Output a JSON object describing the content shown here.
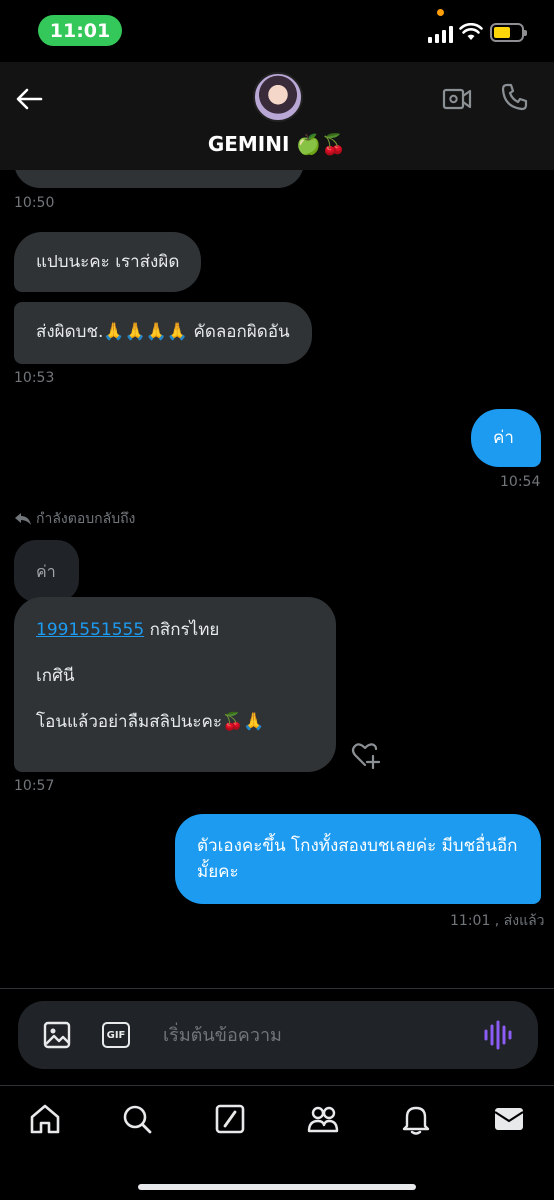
{
  "status_bar": {
    "time": "11:01"
  },
  "header": {
    "contact_name": "GEMINI 🍏🍒"
  },
  "conversation": {
    "time_1": "10:50",
    "msg_1": "แปบนะคะ เราส่งผิด",
    "msg_2": "ส่งผิดบช.🙏🙏🙏🙏 คัดลอกผิดอัน",
    "time_2": "10:53",
    "msg_3": "ค่า",
    "time_3": "10:54",
    "reply_label": "กำลังตอบกลับถึง",
    "quoted_text": "ค่า",
    "msg_4_account": "1991551555",
    "msg_4_bank": " กสิกรไทย",
    "msg_4_name": "เกศินี",
    "msg_4_note": "โอนแล้วอย่าลืมสลิปนะคะ🍒🙏",
    "time_4": "10:57",
    "msg_5": "ตัวเองคะขึ้น โกงทั้งสองบชเลยค่ะ มีบชอื่นอีกมั้ยคะ",
    "time_5": "11:01 , ส่งแล้ว"
  },
  "composer": {
    "placeholder": "เริ่มต้นข้อความ",
    "gif_label": "GIF"
  },
  "icons": {
    "back": "arrow-left-icon",
    "video": "video-camera-icon",
    "call": "phone-icon",
    "image": "image-icon",
    "voice": "waveform-icon",
    "nav": [
      "home-icon",
      "search-icon",
      "grok-icon",
      "communities-icon",
      "bell-icon",
      "mail-icon"
    ]
  },
  "colors": {
    "accent": "#1d9bf0",
    "incoming_bubble": "#2f3336",
    "status_pill": "#34c759",
    "voice": "#8b5cf6"
  }
}
